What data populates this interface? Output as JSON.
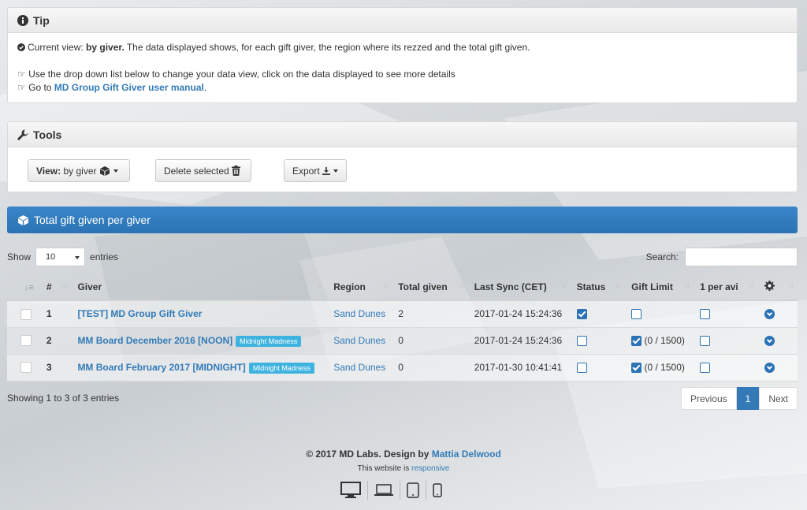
{
  "tip": {
    "title": "Tip",
    "line1_prefix": "Current view: ",
    "line1_bold": "by giver.",
    "line1_rest": " The data displayed shows, for each gift giver, the region where its rezzed and the total gift given.",
    "line2": "Use the drop down list below to change your data view, click on the data displayed to see more details",
    "line3_prefix": "Go to ",
    "line3_link": "MD Group Gift Giver user manual",
    "line3_suffix": "."
  },
  "tools": {
    "title": "Tools",
    "view_label": "View:",
    "view_value": "by giver",
    "delete_label": "Delete selected",
    "export_label": "Export"
  },
  "section": {
    "title": "Total gift given per giver"
  },
  "table_controls": {
    "show_label": "Show",
    "entries_value": "10",
    "entries_label": "entries",
    "search_label": "Search:"
  },
  "table": {
    "headers": {
      "num": "#",
      "giver": "Giver",
      "region": "Region",
      "total": "Total given",
      "sync": "Last Sync (CET)",
      "status": "Status",
      "limit": "Gift Limit",
      "per_avi": "1 per avi"
    },
    "rows": [
      {
        "num": "1",
        "giver": "[TEST] MD Group Gift Giver",
        "badge": "",
        "region": "Sand Dunes",
        "total": "2",
        "sync": "2017-01-24 15:24:36",
        "status": true,
        "limit": false,
        "limit_text": "",
        "per_avi": false
      },
      {
        "num": "2",
        "giver": "MM Board December 2016 [NOON]",
        "badge": "Midnight Madness",
        "region": "Sand Dunes",
        "total": "0",
        "sync": "2017-01-24 15:24:36",
        "status": false,
        "limit": true,
        "limit_text": "(0 / 1500)",
        "per_avi": false
      },
      {
        "num": "3",
        "giver": "MM Board February 2017 [MIDNIGHT]",
        "badge": "Midnight Madness",
        "region": "Sand Dunes",
        "total": "0",
        "sync": "2017-01-30 10:41:41",
        "status": false,
        "limit": true,
        "limit_text": "(0 / 1500)",
        "per_avi": false
      }
    ]
  },
  "info": {
    "text": "Showing 1 to 3 of 3 entries"
  },
  "pager": {
    "prev": "Previous",
    "page": "1",
    "next": "Next"
  },
  "footer": {
    "copy_prefix": "© 2017 MD Labs. Design by ",
    "copy_link": "Mattia Delwood",
    "resp_prefix": "This website is ",
    "resp_link": "responsive"
  }
}
